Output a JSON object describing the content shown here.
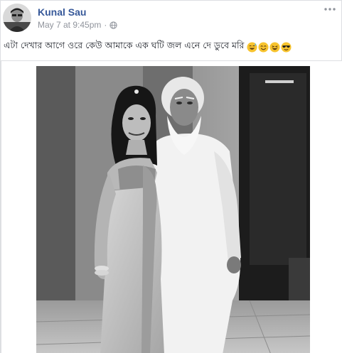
{
  "post": {
    "author": "Kunal Sau",
    "timestamp": "May 7 at 9:45pm",
    "audience_icon": "globe-icon",
    "more_icon": "more-options-icon",
    "caption": "এটা দেখার আগে ওরে কেউ আমাকে এক ঘটি জল এনে দে ডুবে মরি",
    "emojis": [
      "grinning-sweat-emoji",
      "smiling-emoji",
      "laughing-emoji",
      "sunglasses-emoji"
    ],
    "colors": {
      "author_link": "#365899",
      "meta_text": "#90949c",
      "body_text": "#1d2129",
      "border": "#dddfe2"
    }
  }
}
